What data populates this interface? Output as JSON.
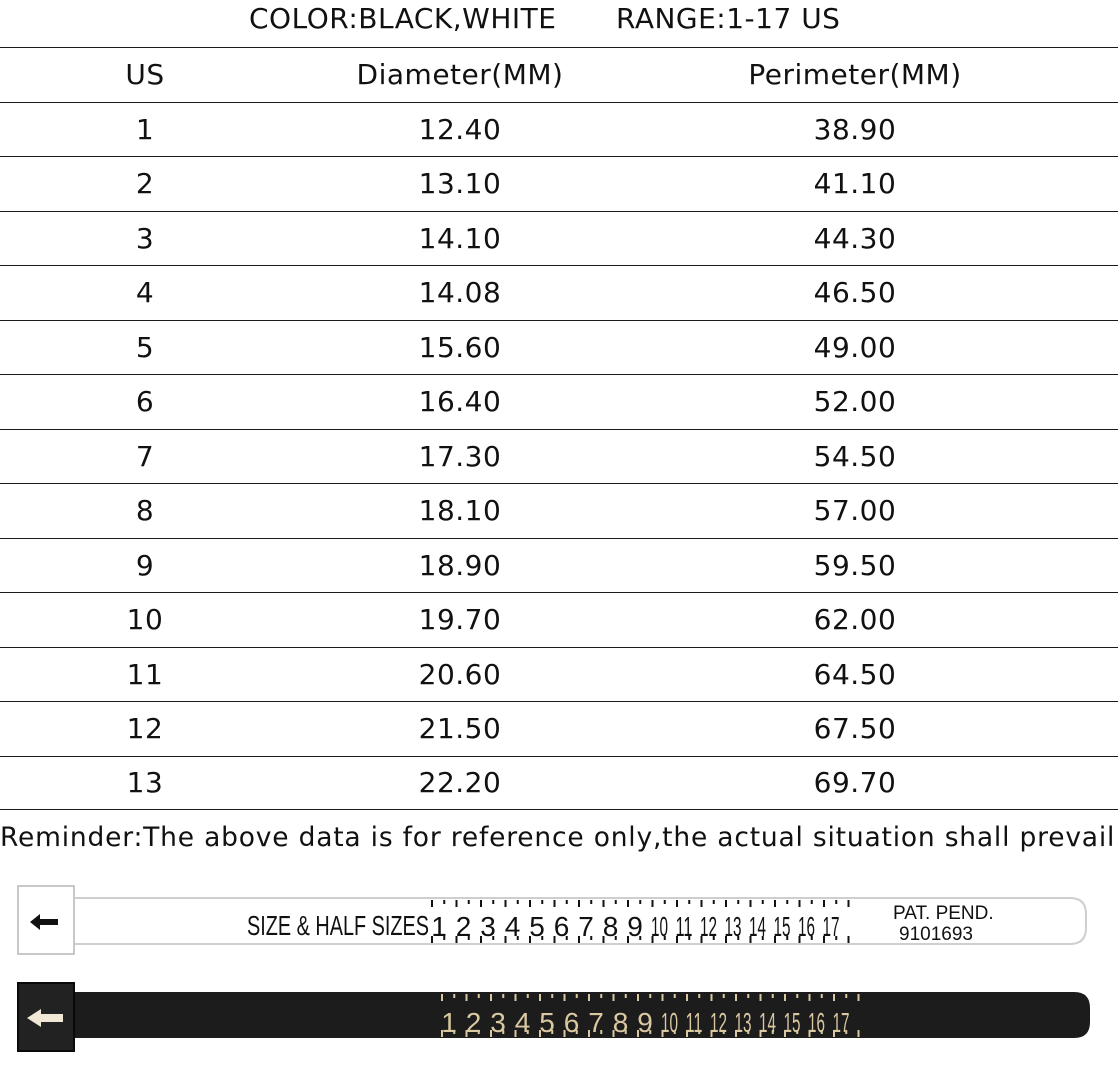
{
  "header": {
    "color_label": "COLOR:BLACK,WHITE",
    "range_label": "RANGE:1-17 US"
  },
  "table": {
    "headers": [
      "US",
      "Diameter(MM)",
      "Perimeter(MM)"
    ],
    "rows": [
      [
        "1",
        "12.40",
        "38.90"
      ],
      [
        "2",
        "13.10",
        "41.10"
      ],
      [
        "3",
        "14.10",
        "44.30"
      ],
      [
        "4",
        "14.08",
        "46.50"
      ],
      [
        "5",
        "15.60",
        "49.00"
      ],
      [
        "6",
        "16.40",
        "52.00"
      ],
      [
        "7",
        "17.30",
        "54.50"
      ],
      [
        "8",
        "18.10",
        "57.00"
      ],
      [
        "9",
        "18.90",
        "59.50"
      ],
      [
        "10",
        "19.70",
        "62.00"
      ],
      [
        "11",
        "20.60",
        "64.50"
      ],
      [
        "12",
        "21.50",
        "67.50"
      ],
      [
        "13",
        "22.20",
        "69.70"
      ]
    ]
  },
  "reminder": "Reminder:The above data is for reference only,the actual situation shall prevail.",
  "white_sizer": {
    "label": "SIZE & HALF SIZES",
    "sizes": [
      "1",
      "2",
      "3",
      "4",
      "5",
      "6",
      "7",
      "8",
      "9",
      "10",
      "11",
      "12",
      "13",
      "14",
      "15",
      "16",
      "17"
    ],
    "pat_label": "PAT. PEND.",
    "pat_number": "9101693",
    "arrow_icon": "left-arrow-icon",
    "strap_color": "#ffffff",
    "text_color": "#111111"
  },
  "black_sizer": {
    "sizes": [
      "1",
      "2",
      "3",
      "4",
      "5",
      "6",
      "7",
      "8",
      "9",
      "10",
      "11",
      "12",
      "13",
      "14",
      "15",
      "16",
      "17"
    ],
    "arrow_icon": "left-arrow-icon",
    "strap_color": "#1c1c1c",
    "text_color": "#d9c8a0"
  }
}
